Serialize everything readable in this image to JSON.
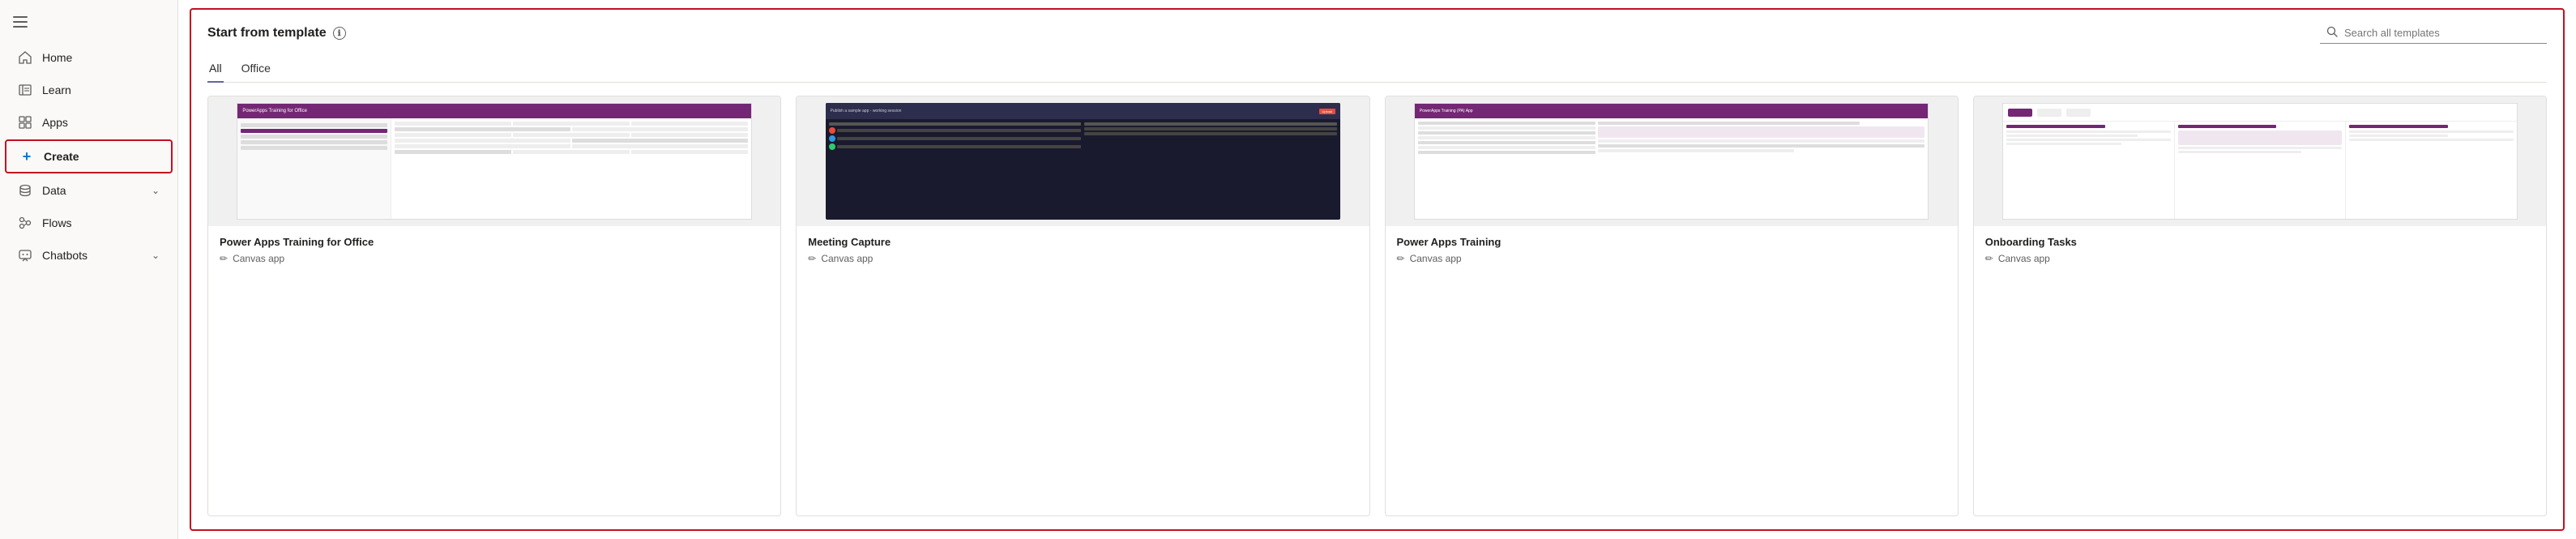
{
  "sidebar": {
    "hamburger_label": "☰",
    "items": [
      {
        "id": "home",
        "label": "Home",
        "icon": "⌂"
      },
      {
        "id": "learn",
        "label": "Learn",
        "icon": "📖"
      },
      {
        "id": "apps",
        "label": "Apps",
        "icon": "⊞"
      },
      {
        "id": "create",
        "label": "Create",
        "icon": "+"
      },
      {
        "id": "data",
        "label": "Data",
        "icon": "⊏",
        "has_chevron": true
      },
      {
        "id": "flows",
        "label": "Flows",
        "icon": "⬡"
      },
      {
        "id": "chatbots",
        "label": "Chatbots",
        "icon": "💬",
        "has_chevron": true
      }
    ]
  },
  "main": {
    "section_title": "Start from template",
    "info_icon_label": "ℹ",
    "search_placeholder": "Search all templates",
    "tabs": [
      {
        "id": "all",
        "label": "All",
        "active": true
      },
      {
        "id": "office",
        "label": "Office",
        "active": false
      }
    ],
    "cards": [
      {
        "id": "card-1",
        "title": "Power Apps Training for Office",
        "type": "Canvas app"
      },
      {
        "id": "card-2",
        "title": "Meeting Capture",
        "type": "Canvas app"
      },
      {
        "id": "card-3",
        "title": "Power Apps Training",
        "type": "Canvas app"
      },
      {
        "id": "card-4",
        "title": "Onboarding Tasks",
        "type": "Canvas app"
      }
    ]
  }
}
